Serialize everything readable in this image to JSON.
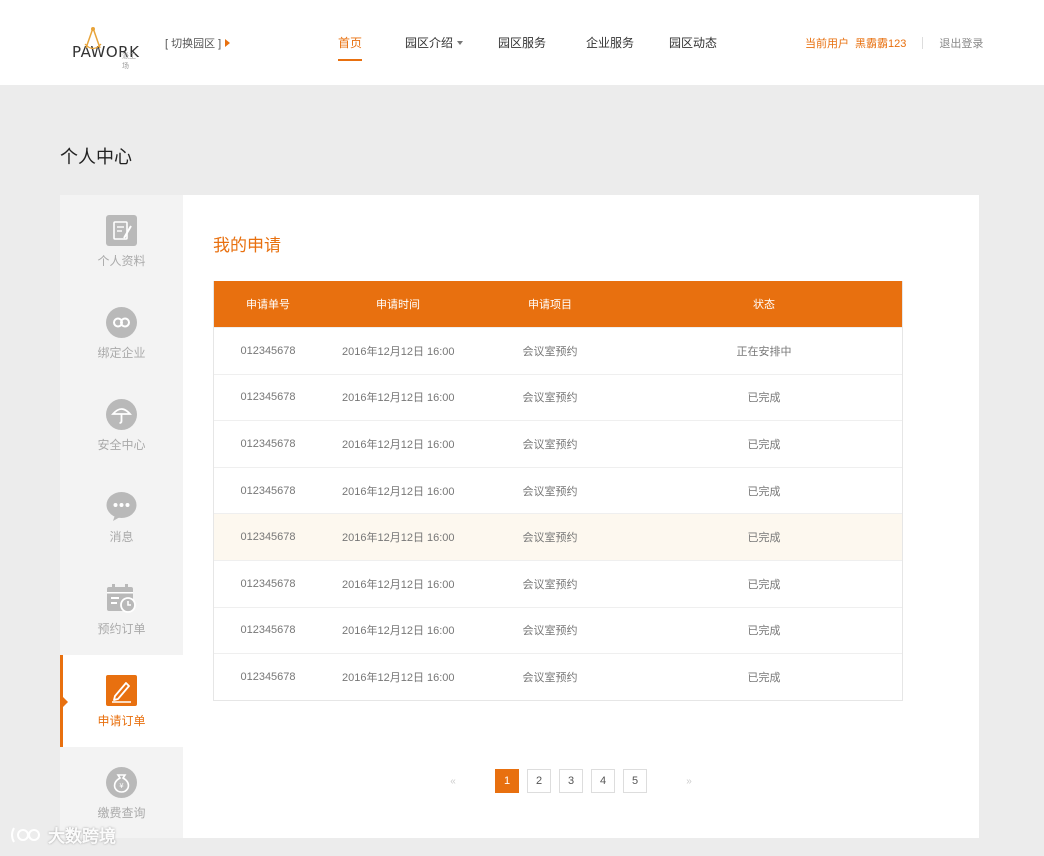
{
  "brand": {
    "logo_text": "PAWORK",
    "logo_sub": "派工场",
    "switch_park": "[ 切换园区 ]"
  },
  "nav": {
    "items": [
      {
        "label": "首页",
        "active": true
      },
      {
        "label": "园区介绍",
        "dropdown": true
      },
      {
        "label": "园区服务"
      },
      {
        "label": "企业服务"
      },
      {
        "label": "园区动态"
      }
    ]
  },
  "user": {
    "label": "当前用户",
    "name": "黑霸霸123",
    "logout": "退出登录"
  },
  "page_title": "个人中心",
  "sidebar": {
    "items": [
      {
        "label": "个人资料",
        "icon": "profile-edit-icon"
      },
      {
        "label": "绑定企业",
        "icon": "link-icon"
      },
      {
        "label": "安全中心",
        "icon": "umbrella-icon"
      },
      {
        "label": "消息",
        "icon": "chat-bubble-icon"
      },
      {
        "label": "预约订单",
        "icon": "calendar-clock-icon"
      },
      {
        "label": "申请订单",
        "icon": "pencil-icon",
        "active": true
      },
      {
        "label": "缴费查询",
        "icon": "money-bag-icon"
      }
    ]
  },
  "main": {
    "title": "我的申请",
    "table": {
      "headers": [
        "申请单号",
        "申请时间",
        "申请项目",
        "状态"
      ],
      "rows": [
        [
          "012345678",
          "2016年12月12日  16:00",
          "会议室预约",
          "正在安排中"
        ],
        [
          "012345678",
          "2016年12月12日  16:00",
          "会议室预约",
          "已完成"
        ],
        [
          "012345678",
          "2016年12月12日  16:00",
          "会议室预约",
          "已完成"
        ],
        [
          "012345678",
          "2016年12月12日  16:00",
          "会议室预约",
          "已完成"
        ],
        [
          "012345678",
          "2016年12月12日  16:00",
          "会议室预约",
          "已完成"
        ],
        [
          "012345678",
          "2016年12月12日  16:00",
          "会议室预约",
          "已完成"
        ],
        [
          "012345678",
          "2016年12月12日  16:00",
          "会议室预约",
          "已完成"
        ],
        [
          "012345678",
          "2016年12月12日  16:00",
          "会议室预约",
          "已完成"
        ]
      ],
      "highlighted_row": 4
    },
    "pagination": {
      "prev": "«",
      "next": "»",
      "pages": [
        "1",
        "2",
        "3",
        "4",
        "5"
      ],
      "current": "1"
    }
  },
  "watermark": "大数跨境",
  "colors": {
    "accent": "#e8700f",
    "header_bg": "#ffffff",
    "page_bg": "#ececec",
    "sidebar_bg": "#f3f3f3",
    "row_highlight": "#fdf8ef"
  }
}
